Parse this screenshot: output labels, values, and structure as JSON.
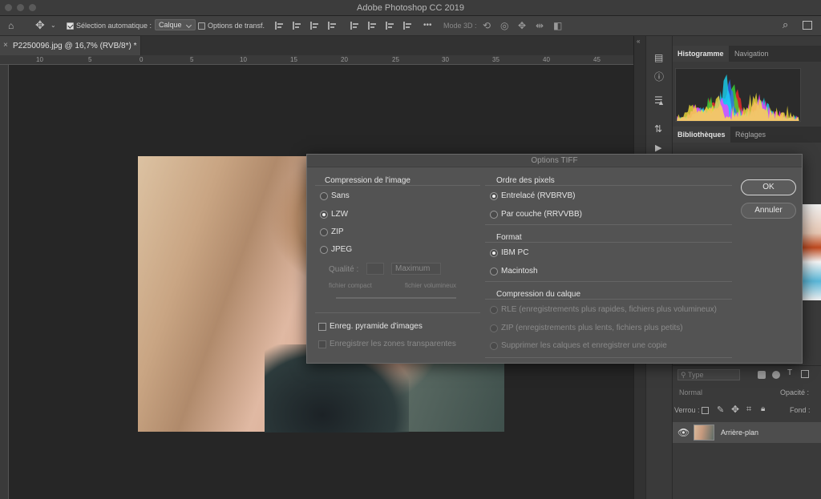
{
  "app": {
    "title": "Adobe Photoshop CC 2019"
  },
  "options_bar": {
    "auto_select_label": "Sélection automatique :",
    "auto_select_value": "Calque",
    "transform_label": "Options de transf.",
    "more_label": "•••",
    "mode3d_label": "Mode 3D :"
  },
  "document": {
    "tab_label": "P2250096.jpg @ 16,7% (RVB/8*) *"
  },
  "rulers": {
    "h": [
      "10",
      "5",
      "0",
      "5",
      "10",
      "15",
      "20",
      "25",
      "30",
      "35",
      "40",
      "45"
    ]
  },
  "panels": {
    "tabs_top": [
      "Histogramme",
      "Navigation"
    ],
    "tabs_mid": [
      "Bibliothèques",
      "Réglages"
    ],
    "histogram_colors": [
      "#ff2a2a",
      "#39e639",
      "#2f6bff",
      "#18e0ff",
      "#ff3bff",
      "#ffe83a"
    ]
  },
  "layers": {
    "filter_placeholder": "Type",
    "blend_mode": "Normal",
    "opacity_label": "Opacité :",
    "lock_label": "Verrou :",
    "fill_label": "Fond :",
    "layer_name": "Arrière-plan"
  },
  "dialog": {
    "title": "Options TIFF",
    "compression": {
      "title": "Compression de l'image",
      "options": [
        "Sans",
        "LZW",
        "ZIP",
        "JPEG"
      ],
      "selected": "LZW",
      "quality_label": "Qualité :",
      "quality_value": "Maximum",
      "compact_label": "fichier compact",
      "large_label": "fichier volumineux"
    },
    "pixel_order": {
      "title": "Ordre des pixels",
      "options": [
        "Entrelacé (RVBRVB)",
        "Par couche (RRVVBB)"
      ],
      "selected": "Entrelacé (RVBRVB)"
    },
    "format": {
      "title": "Format",
      "options": [
        "IBM PC",
        "Macintosh"
      ],
      "selected": "IBM PC"
    },
    "layer_compression": {
      "title": "Compression du calque",
      "options": [
        "RLE (enregistrements plus rapides, fichiers plus volumineux)",
        "ZIP (enregistrements plus lents, fichiers plus petits)",
        "Supprimer les calques et enregistrer une copie"
      ]
    },
    "pyramid_label": "Enreg. pyramide d'images",
    "transparency_label": "Enregistrer les zones transparentes",
    "ok_label": "OK",
    "cancel_label": "Annuler"
  }
}
